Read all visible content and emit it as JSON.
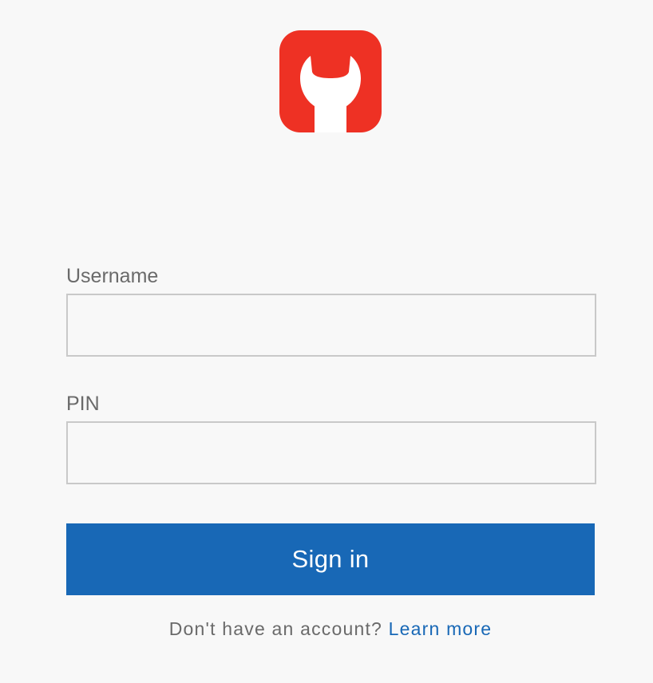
{
  "app": {
    "logo_icon": "wrench-icon",
    "brand_color": "#ee3124"
  },
  "form": {
    "username_label": "Username",
    "username_value": "",
    "pin_label": "PIN",
    "pin_value": "",
    "signin_label": "Sign in",
    "button_color": "#1868b6"
  },
  "footer": {
    "prompt": "Don't have an account?",
    "link_label": "Learn more"
  }
}
